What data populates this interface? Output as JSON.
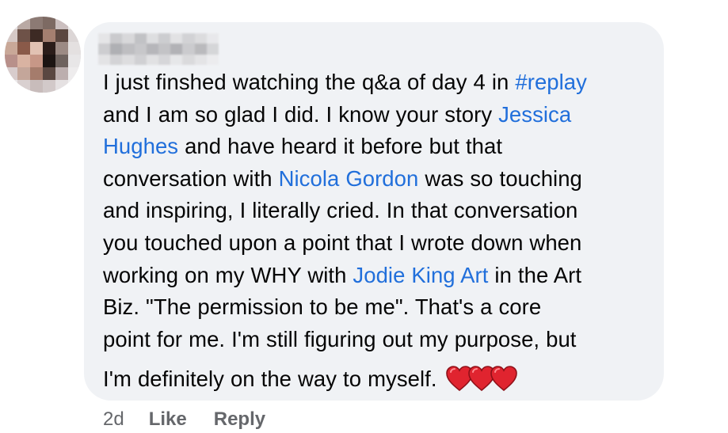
{
  "comment": {
    "author_name": "",
    "lines": [
      [
        {
          "t": "I just finshed watching the q&a of day 4 in "
        },
        {
          "t": "#replay",
          "k": "hashtag"
        }
      ],
      [
        {
          "t": "and I am so glad I did. I know your story "
        },
        {
          "t": "Jessica",
          "k": "mention"
        }
      ],
      [
        {
          "t": "Hughes",
          "k": "mention"
        },
        {
          "t": " and have heard it before but that"
        }
      ],
      [
        {
          "t": "conversation with "
        },
        {
          "t": "Nicola Gordon",
          "k": "mention"
        },
        {
          "t": " was so touching"
        }
      ],
      [
        {
          "t": "and inspiring, I literally cried. In that conversation"
        }
      ],
      [
        {
          "t": "you touched upon a point that I wrote down when"
        }
      ],
      [
        {
          "t": "working on my WHY with "
        },
        {
          "t": "Jodie King Art",
          "k": "mention"
        },
        {
          "t": " in the Art"
        }
      ],
      [
        {
          "t": "Biz. \"The permission to be me\". That's a core"
        }
      ],
      [
        {
          "t": "point for me. I'm still figuring out my purpose, but"
        }
      ],
      [
        {
          "t": "I'm definitely on the way to myself."
        }
      ]
    ],
    "emoji": [
      "heart-icon",
      "heart-icon",
      "heart-icon"
    ]
  },
  "actions": {
    "time": "2d",
    "like_label": "Like",
    "reply_label": "Reply"
  },
  "colors": {
    "bubble_bg": "#f0f2f5",
    "link": "#216fdb",
    "meta": "#65676b",
    "heart": "#e0242f"
  }
}
